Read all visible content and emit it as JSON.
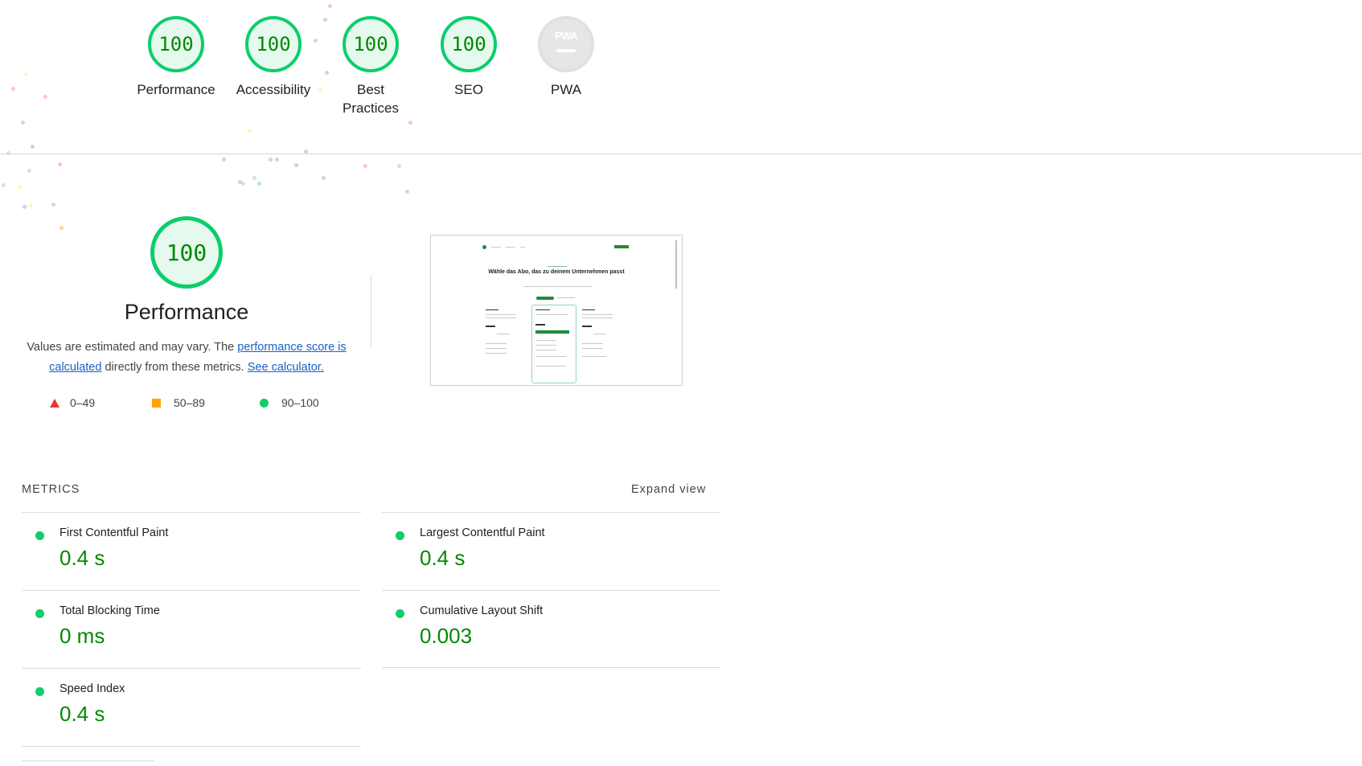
{
  "gauges": [
    {
      "score": "100",
      "label": "Performance"
    },
    {
      "score": "100",
      "label": "Accessibility"
    },
    {
      "score": "100",
      "label": "Best Practices"
    },
    {
      "score": "100",
      "label": "SEO"
    },
    {
      "badge": "PWA",
      "label": "PWA"
    }
  ],
  "performance": {
    "score": "100",
    "title": "Performance",
    "desc_prefix": "Values are estimated and may vary. The ",
    "score_link": "performance score is calculated",
    "desc_mid": " directly from these metrics. ",
    "calc_link": "See calculator.",
    "legend": [
      "0–49",
      "50–89",
      "90–100"
    ]
  },
  "thumbnail": {
    "heading": "Wähle das Abo, das zu deinem Unternehmen passt"
  },
  "metrics": {
    "title": "METRICS",
    "expand_label": "Expand view",
    "items": [
      {
        "name": "First Contentful Paint",
        "value": "0.4 s"
      },
      {
        "name": "Largest Contentful Paint",
        "value": "0.4 s"
      },
      {
        "name": "Total Blocking Time",
        "value": "0 ms"
      },
      {
        "name": "Cumulative Layout Shift",
        "value": "0.003"
      },
      {
        "name": "Speed Index",
        "value": "0.4 s"
      }
    ]
  },
  "colors": {
    "pass": "#0cce6b",
    "pass_text": "#008a00",
    "average": "#ffa400",
    "fail": "#e53935",
    "link": "#1a5fc4"
  }
}
